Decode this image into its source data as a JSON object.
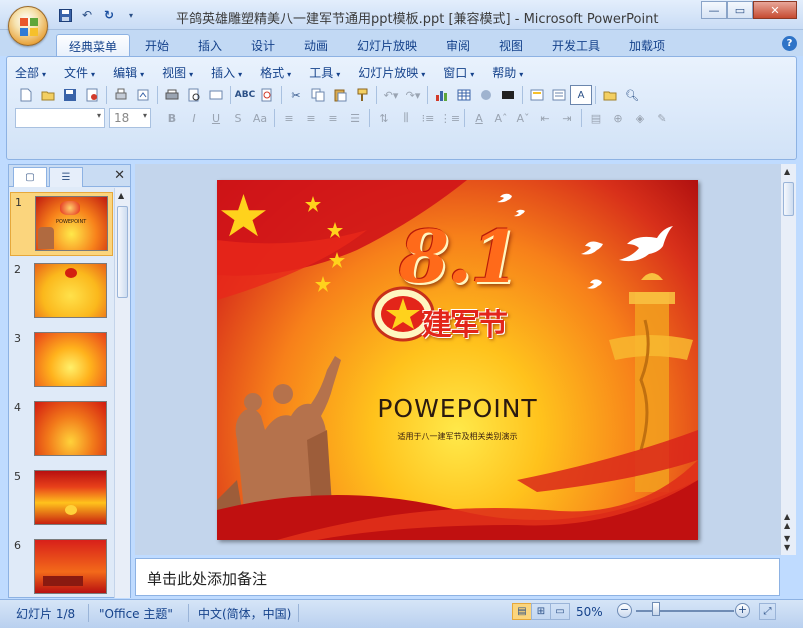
{
  "window": {
    "title": "平鸽英雄雕塑精美八一建军节通用ppt模板.ppt [兼容模式] - Microsoft PowerPoint",
    "qat_icons": [
      "save-icon",
      "undo-icon",
      "redo-icon",
      "customize-icon"
    ]
  },
  "ribbon": {
    "tabs": [
      "经典菜单",
      "开始",
      "插入",
      "设计",
      "动画",
      "幻灯片放映",
      "审阅",
      "视图",
      "开发工具",
      "加载项"
    ],
    "active_tab": 0,
    "menus": [
      "全部",
      "文件",
      "编辑",
      "视图",
      "插入",
      "格式",
      "工具",
      "幻灯片放映",
      "窗口",
      "帮助"
    ],
    "font_name": "",
    "font_size": "18"
  },
  "left_pane": {
    "thumbnails": [
      {
        "num": "1",
        "title": "POWEPOINT",
        "theme": "cover"
      },
      {
        "num": "2",
        "theme": "gold-emblem"
      },
      {
        "num": "3",
        "theme": "orange-glow"
      },
      {
        "num": "4",
        "theme": "sunset"
      },
      {
        "num": "5",
        "theme": "red-curtain"
      },
      {
        "num": "6",
        "theme": "tiananmen"
      }
    ],
    "selected": 0
  },
  "slide": {
    "headline": "8.1",
    "badge_text": "建军节",
    "title": "POWEPOINT",
    "subtitle": "适用于八一建军节及相关类别演示"
  },
  "notes": {
    "placeholder": "单击此处添加备注"
  },
  "status": {
    "slide_indicator": "幻灯片 1/8",
    "theme": "\"Office 主题\"",
    "language": "中文(简体，中国)",
    "zoom": "50%"
  },
  "colors": {
    "ribbon_bg": "#d1e2f7",
    "accent": "#15428b",
    "selection": "#fbd57d",
    "slide_red": "#d8301a",
    "slide_gold": "#ffc21c"
  }
}
